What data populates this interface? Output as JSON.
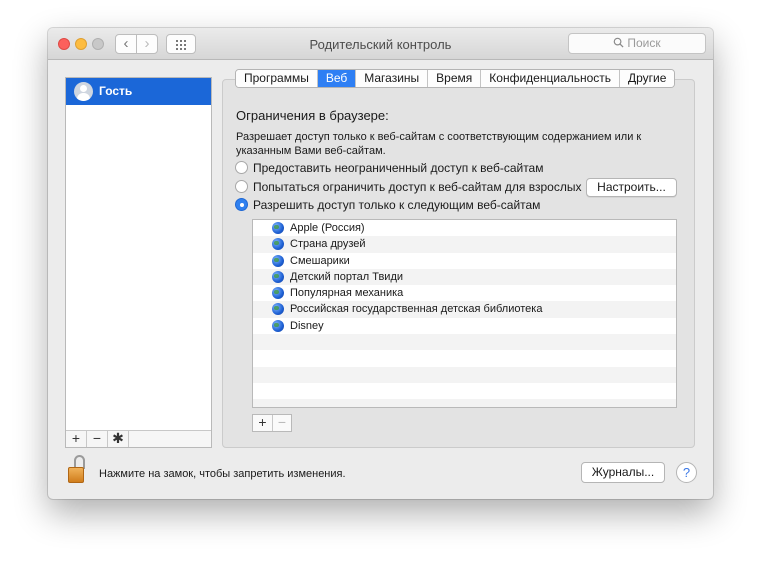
{
  "window": {
    "title": "Родительский контроль",
    "back_icon": "‹",
    "forward_icon": "›"
  },
  "search": {
    "placeholder": "Поиск",
    "icon": "search-icon"
  },
  "sidebar": {
    "users": [
      {
        "name": "Гость",
        "selected": true
      }
    ],
    "tools": {
      "add": "+",
      "remove": "−",
      "gear": "✱"
    }
  },
  "tabs": [
    {
      "label": "Программы",
      "active": false
    },
    {
      "label": "Веб",
      "active": true
    },
    {
      "label": "Магазины",
      "active": false
    },
    {
      "label": "Время",
      "active": false
    },
    {
      "label": "Конфиденциальность",
      "active": false
    },
    {
      "label": "Другие",
      "active": false
    }
  ],
  "web": {
    "heading": "Ограничения в браузере:",
    "description": "Разрешает доступ только к веб-сайтам с соответствующим содержанием или к указанным Вами веб-сайтам.",
    "options": [
      {
        "label": "Предоставить неограниченный доступ к веб-сайтам",
        "selected": false
      },
      {
        "label": "Попытаться ограничить доступ к веб-сайтам для взрослых",
        "selected": false
      },
      {
        "label": "Разрешить доступ только к следующим веб-сайтам",
        "selected": true
      }
    ],
    "configure_button": "Настроить...",
    "sites": [
      "Apple (Россия)",
      "Страна друзей",
      "Смешарики",
      "Детский портал Твиди",
      "Популярная механика",
      "Российская государственная детская библиотека",
      "Disney"
    ],
    "list_tools": {
      "add": "+",
      "remove": "−"
    }
  },
  "footer": {
    "lock_text": "Нажмите на замок, чтобы запретить изменения.",
    "logs_button": "Журналы...",
    "help": "?"
  },
  "colors": {
    "accent": "#2e7ff4",
    "selection": "#1b67d8"
  }
}
